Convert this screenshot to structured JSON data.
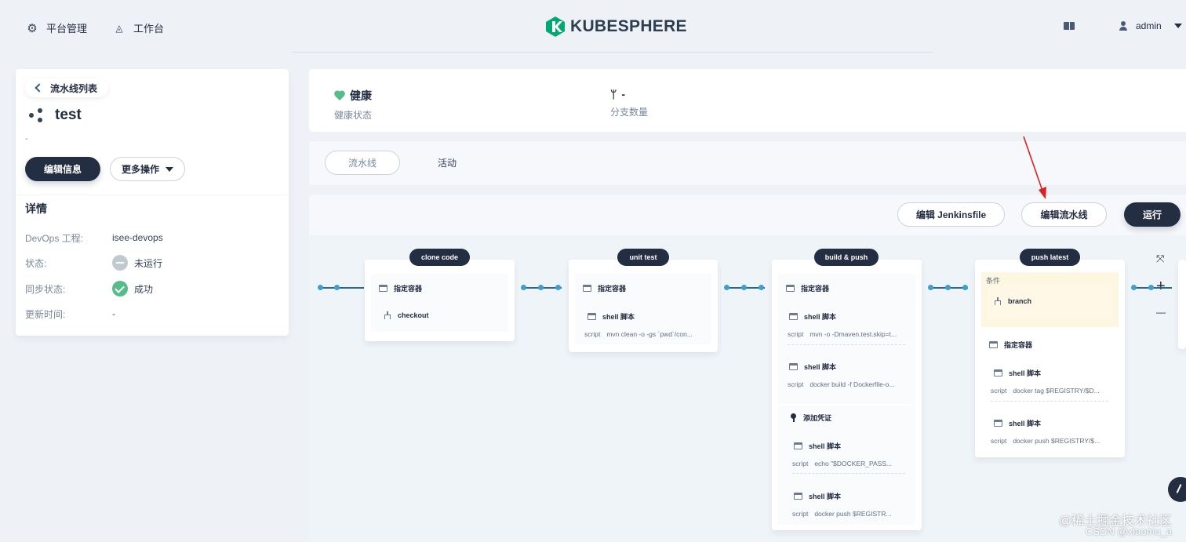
{
  "topbar": {
    "platform_label": "平台管理",
    "workbench_label": "工作台",
    "logo_text": "KUBESPHERE",
    "user_name": "admin"
  },
  "left": {
    "back_label": "流水线列表",
    "pipeline_name": "test",
    "description": "-",
    "edit_info_label": "编辑信息",
    "more_actions_label": "更多操作",
    "details_title": "详情",
    "details": [
      {
        "key": "DevOps 工程:",
        "value": "isee-devops"
      },
      {
        "key": "状态:",
        "value": "未运行"
      },
      {
        "key": "同步状态:",
        "value": "成功"
      },
      {
        "key": "更新时间:",
        "value": "-"
      }
    ]
  },
  "stats": {
    "health_value": "健康",
    "health_label": "健康状态",
    "branch_value": "-",
    "branch_label": "分支数量"
  },
  "tabs": [
    "流水线",
    "活动"
  ],
  "toolbar": {
    "edit_jenkinsfile_label": "编辑 Jenkinsfile",
    "edit_pipeline_label": "编辑流水线",
    "run_label": "运行"
  },
  "stages": [
    {
      "name": "clone code",
      "container": "指定容器",
      "steps": [
        {
          "title": "checkout",
          "script": ""
        }
      ]
    },
    {
      "name": "unit test",
      "container": "指定容器",
      "steps": [
        {
          "title": "shell 脚本",
          "script": "mvn clean -o -gs `pwd`/con..."
        }
      ]
    },
    {
      "name": "build & push",
      "container": "指定容器",
      "steps": [
        {
          "title": "shell 脚本",
          "script": "mvn -o -Dmaven.test.skip=t..."
        },
        {
          "title": "shell 脚本",
          "script": "docker build -f Dockerfile-o..."
        }
      ],
      "credential": {
        "title": "添加凭证",
        "steps": [
          {
            "title": "shell 脚本",
            "script": "echo \"$DOCKER_PASS..."
          },
          {
            "title": "shell 脚本",
            "script": "docker push $REGISTR..."
          }
        ]
      }
    },
    {
      "name": "push latest",
      "condition_title": "条件",
      "condition_item": "branch",
      "container": "指定容器",
      "steps": [
        {
          "title": "shell 脚本",
          "script": "docker tag $REGISTRY/$D..."
        },
        {
          "title": "shell 脚本",
          "script": "docker push $REGISTRY/$..."
        }
      ]
    }
  ],
  "script_key": "script",
  "canvas_controls": {
    "fit": "⤧",
    "zoom_in": "+",
    "zoom_out": "—"
  },
  "watermarks": [
    "@稀土掘金技术社区",
    "CSDN @xiaomu_a"
  ],
  "colors": {
    "dark": "#242e42",
    "success": "#55bc8a",
    "annotation_arrow": "#e02020",
    "connector_dot": "#3e9fcf"
  }
}
